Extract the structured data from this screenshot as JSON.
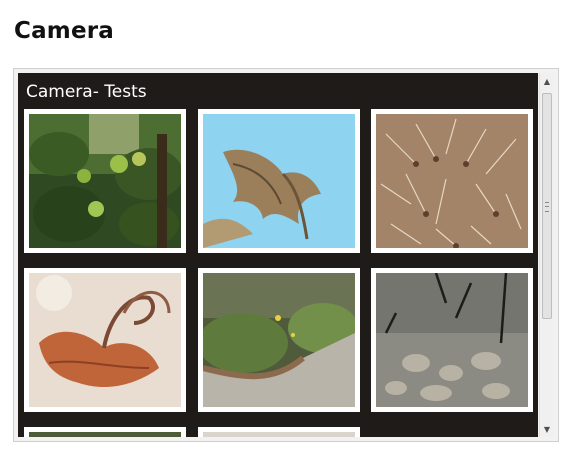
{
  "page": {
    "title": "Camera"
  },
  "gallery": {
    "title": "Camera- Tests",
    "photos": [
      {
        "subject": "apple-tree-photo"
      },
      {
        "subject": "dried-seedpod-sky-photo"
      },
      {
        "subject": "feathery-seeds-photo"
      },
      {
        "subject": "curled-dry-leaf-photo"
      },
      {
        "subject": "garden-path-photo"
      },
      {
        "subject": "pond-stones-photo"
      },
      {
        "subject": "partial-photo-7"
      },
      {
        "subject": "partial-photo-8"
      }
    ]
  },
  "scrollbar": {
    "up_icon": "arrow-up-icon",
    "down_icon": "arrow-down-icon",
    "thumb_fraction": 0.62
  },
  "colors": {
    "gallery_background": "#1e1b19",
    "title_text": "#ffffff",
    "tile_border": "#ffffff"
  }
}
